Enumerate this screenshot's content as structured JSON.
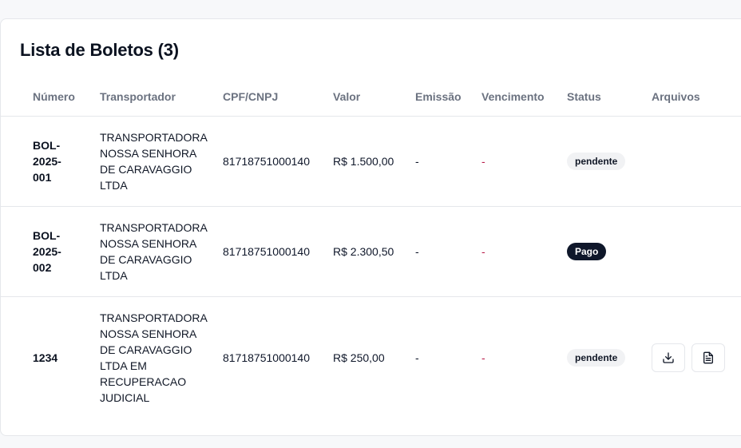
{
  "title": "Lista de Boletos (3)",
  "columns": {
    "numero": "Número",
    "transportador": "Transportador",
    "cpf": "CPF/CNPJ",
    "valor": "Valor",
    "emissao": "Emissão",
    "vencimento": "Vencimento",
    "status": "Status",
    "arquivos": "Arquivos"
  },
  "rows": [
    {
      "numero": [
        "BOL-",
        "2025-",
        "001"
      ],
      "transportador": [
        "TRANSPORTADORA",
        "NOSSA SENHORA",
        "DE CARAVAGGIO",
        "LTDA"
      ],
      "cpf": "81718751000140",
      "valor": "R$ 1.500,00",
      "emissao": "-",
      "vencimento": "-",
      "status": "pendente"
    },
    {
      "numero": [
        "BOL-",
        "2025-",
        "002"
      ],
      "transportador": [
        "TRANSPORTADORA",
        "NOSSA SENHORA",
        "DE CARAVAGGIO",
        "LTDA"
      ],
      "cpf": "81718751000140",
      "valor": "R$ 2.300,50",
      "emissao": "-",
      "vencimento": "-",
      "status": "Pago"
    },
    {
      "numero": [
        "1234"
      ],
      "transportador": [
        "TRANSPORTADORA",
        "NOSSA SENHORA",
        "DE CARAVAGGIO",
        "LTDA EM",
        "RECUPERACAO",
        "JUDICIAL"
      ],
      "cpf": "81718751000140",
      "valor": "R$ 250,00",
      "emissao": "-",
      "vencimento": "-",
      "status": "pendente",
      "files": [
        "download-icon",
        "file-text-icon"
      ]
    }
  ],
  "colors": {
    "status_pago_bg": "#0f172a",
    "status_pendente_bg": "#f1f2f4",
    "vencimento_dash": "#b91c4a"
  }
}
